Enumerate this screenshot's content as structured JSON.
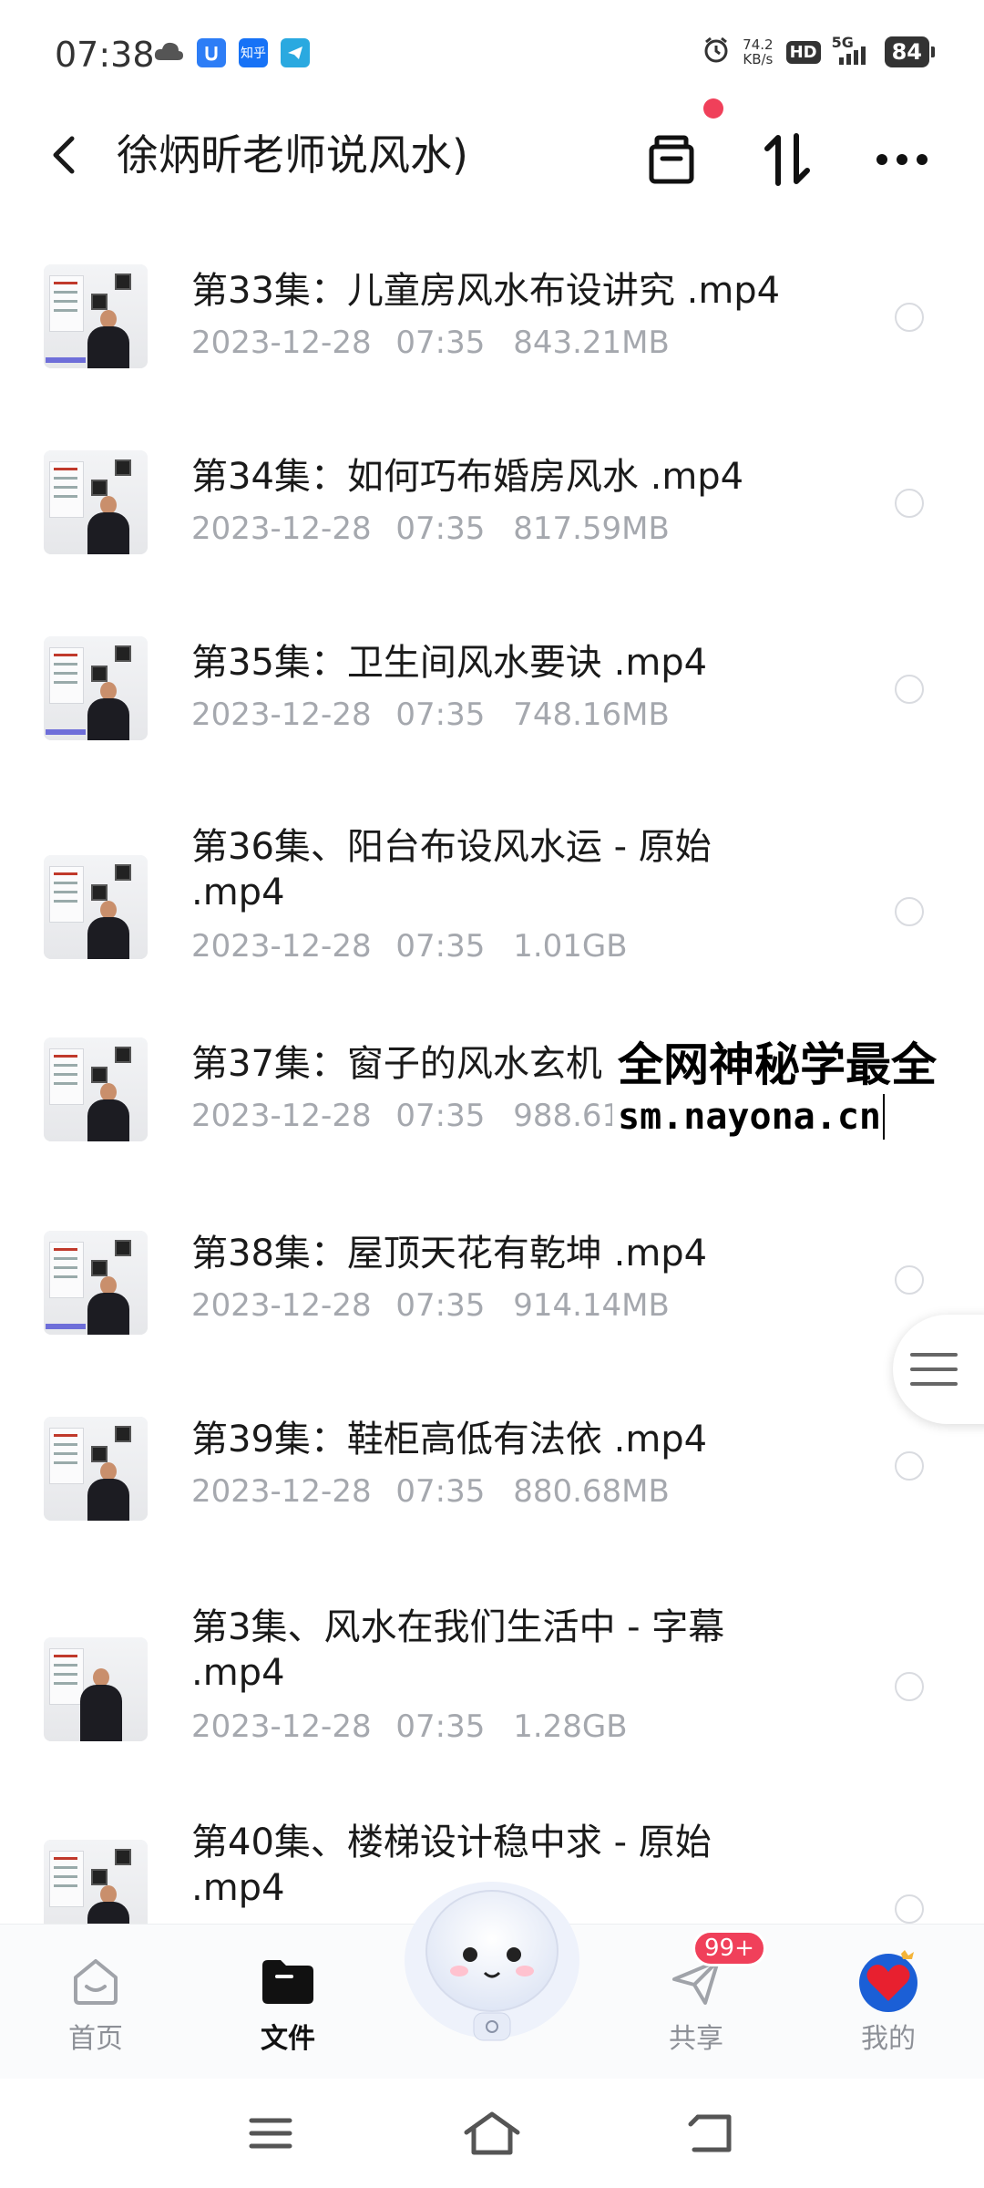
{
  "status_bar": {
    "time": "07:38",
    "app_icons": [
      "cloud-icon",
      "u-app-icon",
      "zhihu-app-icon",
      "telegram-icon"
    ],
    "zhihu_label": "知乎",
    "net_speed_value": "74.2",
    "net_speed_unit": "KB/s",
    "hd_label": "HD",
    "network_label": "5G",
    "battery_level": "84"
  },
  "header": {
    "title": "徐炳昕老师说风水)"
  },
  "files": [
    {
      "name": "第33集：儿童房风水布设讲究 .mp4",
      "date": "2023-12-28",
      "time": "07:35",
      "size": "843.21MB"
    },
    {
      "name": "第34集：如何巧布婚房风水 .mp4",
      "date": "2023-12-28",
      "time": "07:35",
      "size": "817.59MB"
    },
    {
      "name": "第35集：卫生间风水要诀 .mp4",
      "date": "2023-12-28",
      "time": "07:35",
      "size": "748.16MB"
    },
    {
      "name": "第36集、阳台布设风水运 - 原始 .mp4",
      "date": "2023-12-28",
      "time": "07:35",
      "size": "1.01GB"
    },
    {
      "name": "第37集：窗子的风水玄机",
      "date": "2023-12-28",
      "time": "07:35",
      "size": "988.61"
    },
    {
      "name": "第38集：屋顶天花有乾坤 .mp4",
      "date": "2023-12-28",
      "time": "07:35",
      "size": "914.14MB"
    },
    {
      "name": "第39集：鞋柜高低有法依 .mp4",
      "date": "2023-12-28",
      "time": "07:35",
      "size": "880.68MB"
    },
    {
      "name": "第3集、风水在我们生活中 - 字幕 .mp4",
      "date": "2023-12-28",
      "time": "07:35",
      "size": "1.28GB"
    },
    {
      "name": "第40集、楼梯设计稳中求 - 原始 .mp4",
      "date": "",
      "time": "",
      "size": ""
    }
  ],
  "watermark": {
    "line1": "全网神秘学最全",
    "line2": "sm.nayona.cn"
  },
  "bottom_nav": {
    "items": [
      {
        "label": "首页",
        "icon": "home-icon"
      },
      {
        "label": "文件",
        "icon": "folder-icon",
        "active": true
      },
      {
        "label": "共享",
        "icon": "send-icon",
        "badge": "99+"
      },
      {
        "label": "我的",
        "icon": "heart-avatar-icon"
      }
    ]
  },
  "colors": {
    "accent_red": "#f0405a",
    "meta_gray": "#a5a8ae",
    "text": "#1a1a1a"
  }
}
